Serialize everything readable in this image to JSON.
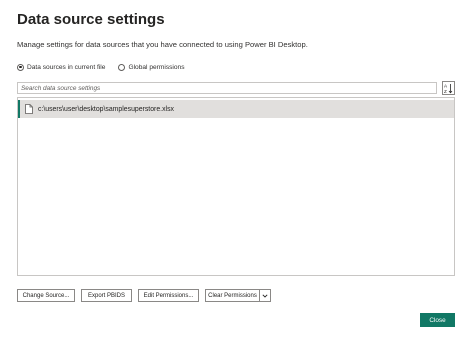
{
  "dialog": {
    "title": "Data source settings",
    "description": "Manage settings for data sources that you have connected to using Power BI Desktop."
  },
  "scope": {
    "options": [
      {
        "label": "Data sources in current file",
        "selected": true
      },
      {
        "label": "Global permissions",
        "selected": false
      }
    ]
  },
  "search": {
    "placeholder": "Search data source settings",
    "value": ""
  },
  "sort_icon": "sort-az-icon",
  "sources": [
    {
      "path": "c:\\users\\user\\desktop\\samplesuperstore.xlsx",
      "icon": "file-icon",
      "selected": true
    }
  ],
  "buttons": {
    "change_source": "Change Source...",
    "export_pbids": "Export PBIDS",
    "edit_permissions": "Edit Permissions...",
    "clear_permissions": "Clear Permissions",
    "close": "Close"
  },
  "colors": {
    "accent": "#117865",
    "selected_row": "#e1dfdd",
    "border": "#8a8886"
  }
}
